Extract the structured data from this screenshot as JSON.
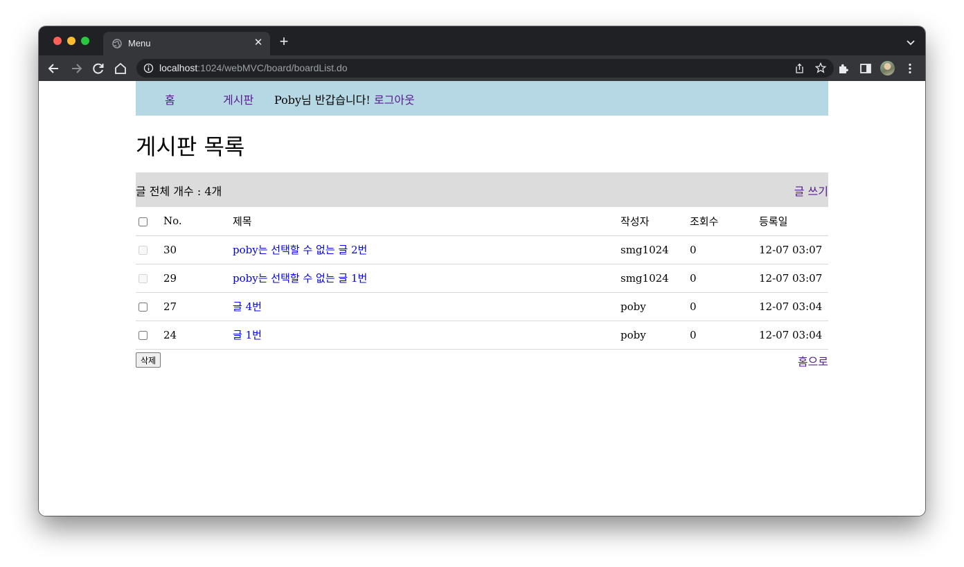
{
  "browser": {
    "tab_title": "Menu",
    "url_host": "localhost",
    "url_rest": ":1024/webMVC/board/boardList.do"
  },
  "nav": {
    "home": "홈",
    "board": "게시판",
    "greeting": "Poby님 반갑습니다!",
    "logout": "로그아웃"
  },
  "page": {
    "title": "게시판 목록",
    "total_count_text": "글 전체 개수 : 4개",
    "write_link": "글 쓰기",
    "delete_button": "삭제",
    "home_link": "홈으로"
  },
  "table": {
    "headers": {
      "no": "No.",
      "title": "제목",
      "writer": "작성자",
      "views": "조회수",
      "date": "등록일"
    },
    "rows": [
      {
        "no": "30",
        "title": "poby는 선택할 수 없는 글 2번",
        "writer": "smg1024",
        "views": "0",
        "date": "12-07 03:07",
        "selectable": false
      },
      {
        "no": "29",
        "title": "poby는 선택할 수 없는 글 1번",
        "writer": "smg1024",
        "views": "0",
        "date": "12-07 03:07",
        "selectable": false
      },
      {
        "no": "27",
        "title": "글 4번",
        "writer": "poby",
        "views": "0",
        "date": "12-07 03:04",
        "selectable": true
      },
      {
        "no": "24",
        "title": "글 1번",
        "writer": "poby",
        "views": "0",
        "date": "12-07 03:04",
        "selectable": true
      }
    ]
  },
  "colors": {
    "nav_bg": "#b6d8e4",
    "count_bar_bg": "#dcdcdc",
    "visited_link": "#551a8b",
    "link": "#0000ee"
  }
}
